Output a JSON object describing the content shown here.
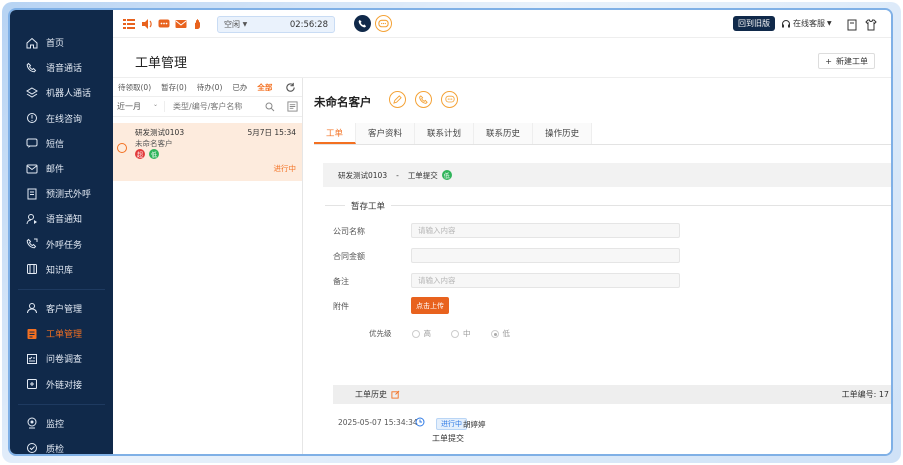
{
  "sidebar": {
    "items": [
      {
        "label": "首页",
        "icon": "home-icon"
      },
      {
        "label": "语音通话",
        "icon": "phone-icon"
      },
      {
        "label": "机器人通话",
        "icon": "robot-icon"
      },
      {
        "label": "在线咨询",
        "icon": "chat-icon"
      },
      {
        "label": "短信",
        "icon": "sms-icon"
      },
      {
        "label": "邮件",
        "icon": "mail-icon"
      },
      {
        "label": "预测式外呼",
        "icon": "predict-call-icon"
      },
      {
        "label": "语音通知",
        "icon": "voice-notice-icon"
      },
      {
        "label": "外呼任务",
        "icon": "outbound-task-icon"
      },
      {
        "label": "知识库",
        "icon": "book-icon"
      }
    ],
    "items2": [
      {
        "label": "客户管理",
        "icon": "customer-icon"
      },
      {
        "label": "工单管理",
        "icon": "ticket-icon",
        "active": true
      },
      {
        "label": "问卷调查",
        "icon": "survey-icon"
      },
      {
        "label": "外链对接",
        "icon": "link-icon"
      }
    ],
    "items3": [
      {
        "label": "监控",
        "icon": "monitor-icon"
      },
      {
        "label": "质检",
        "icon": "quality-icon"
      }
    ]
  },
  "topbar": {
    "status": "空闲",
    "timer": "02:56:28",
    "old_version_label": "回到旧版",
    "online_service_label": "在线客服"
  },
  "page": {
    "title": "工单管理",
    "new_ticket_label": "新建工单"
  },
  "list": {
    "tabs": [
      "待领取(0)",
      "暂存(0)",
      "待办(0)",
      "已办",
      "全部"
    ],
    "period": "近一月",
    "search_placeholder": "类型/编号/客户名称",
    "ticket": {
      "name": "研发测试0103",
      "time": "5月7日 15:34",
      "customer": "未命名客户",
      "tags": [
        {
          "text": "超",
          "color": "#e23b3b"
        },
        {
          "text": "低",
          "color": "#2fb45a"
        }
      ],
      "state": "进行中"
    }
  },
  "detail": {
    "customer_name": "未命名客户",
    "tabs": [
      "工单",
      "客户资料",
      "联系计划",
      "联系历史",
      "操作历史"
    ],
    "info": {
      "name": "研发测试0103",
      "sep": "-",
      "step": "工单提交",
      "tag": "低"
    },
    "save_title": "暂存工单",
    "fields": {
      "company_label": "公司名称",
      "company_placeholder": "请输入内容",
      "amount_label": "合同金额",
      "remark_label": "备注",
      "remark_placeholder": "请输入内容",
      "attach_label": "附件",
      "upload_label": "点击上传"
    },
    "priority": {
      "label": "优先级",
      "options": [
        "高",
        "中",
        "低"
      ],
      "selected": "低"
    },
    "history": {
      "title": "工单历史",
      "number_label": "工单编号: 17",
      "time": "2025-05-07 15:34:34",
      "badge": "进行中",
      "user": "胡婷婷",
      "action": "工单提交"
    }
  },
  "colors": {
    "sidebar_bg": "#10294a",
    "accent": "#f37021",
    "primary_dark": "#10294a"
  }
}
